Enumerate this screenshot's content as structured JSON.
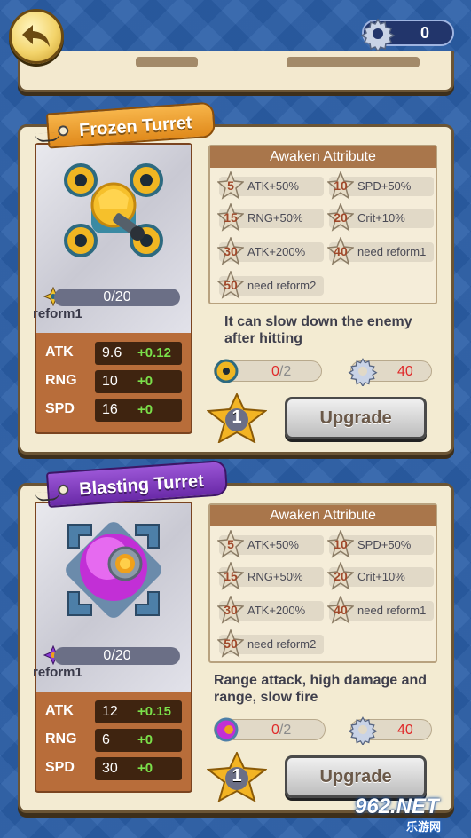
{
  "header": {
    "back_icon": "back-arrow-icon",
    "gear_count": "0"
  },
  "turrets": [
    {
      "name": "Frozen Turret",
      "ribbon_color": "#e08a1c",
      "reform_progress": "0/20",
      "reform_label": "reform1",
      "stats": [
        {
          "name": "ATK",
          "value": "9.6",
          "bonus": "+0.12"
        },
        {
          "name": "RNG",
          "value": "10",
          "bonus": "+0"
        },
        {
          "name": "SPD",
          "value": "16",
          "bonus": "+0"
        }
      ],
      "awaken_title": "Awaken Attribute",
      "attributes": [
        {
          "level": "5",
          "text": "ATK+50%"
        },
        {
          "level": "10",
          "text": "SPD+50%"
        },
        {
          "level": "15",
          "text": "RNG+50%"
        },
        {
          "level": "20",
          "text": "Crit+10%"
        },
        {
          "level": "30",
          "text": "ATK+200%"
        },
        {
          "level": "40",
          "text": "need reform1"
        },
        {
          "level": "50",
          "text": "need reform2"
        }
      ],
      "description": "It can slow down the enemy after hitting",
      "piece_owned": "0",
      "piece_needed": "/2",
      "gear_cost": "40",
      "level": "1",
      "upgrade_label": "Upgrade"
    },
    {
      "name": "Blasting Turret",
      "ribbon_color": "#6a2aa8",
      "reform_progress": "0/20",
      "reform_label": "reform1",
      "stats": [
        {
          "name": "ATK",
          "value": "12",
          "bonus": "+0.15"
        },
        {
          "name": "RNG",
          "value": "6",
          "bonus": "+0"
        },
        {
          "name": "SPD",
          "value": "30",
          "bonus": "+0"
        }
      ],
      "awaken_title": "Awaken Attribute",
      "attributes": [
        {
          "level": "5",
          "text": "ATK+50%"
        },
        {
          "level": "10",
          "text": "SPD+50%"
        },
        {
          "level": "15",
          "text": "RNG+50%"
        },
        {
          "level": "20",
          "text": "Crit+10%"
        },
        {
          "level": "30",
          "text": "ATK+200%"
        },
        {
          "level": "40",
          "text": "need reform1"
        },
        {
          "level": "50",
          "text": "need reform2"
        }
      ],
      "description": "Range attack, high damage and range, slow fire",
      "piece_owned": "0",
      "piece_needed": "/2",
      "gear_cost": "40",
      "level": "1",
      "upgrade_label": "Upgrade"
    }
  ],
  "watermark": {
    "text": "962.NET",
    "sub": "乐游网"
  }
}
